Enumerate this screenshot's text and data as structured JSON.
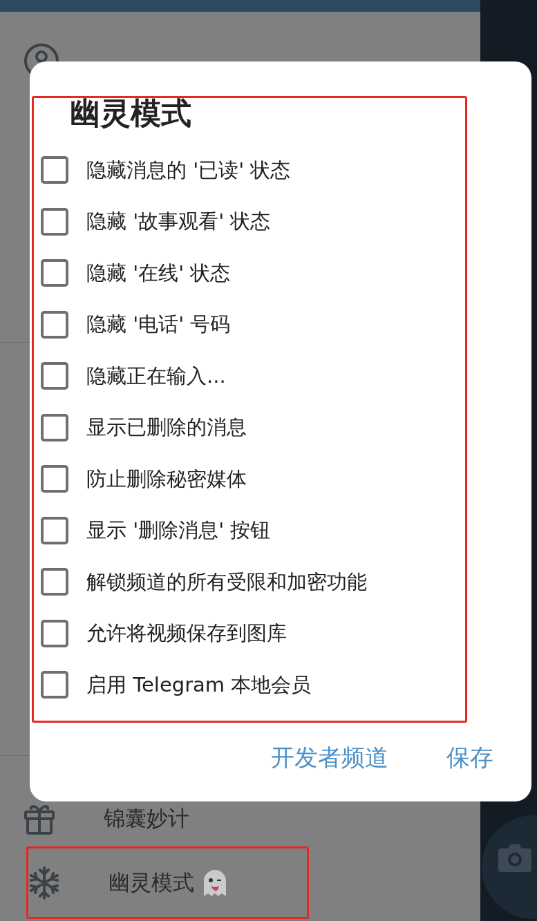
{
  "drawer": {
    "items": [
      {
        "kind": "gift",
        "label": "锦囊妙计",
        "ghost": false,
        "annotated": false
      },
      {
        "kind": "snowflake",
        "label": "幽灵模式",
        "ghost": true,
        "annotated": true
      }
    ]
  },
  "dialog": {
    "title": "幽灵模式",
    "annotated": true,
    "options": [
      {
        "label": "隐藏消息的 '已读' 状态",
        "checked": false
      },
      {
        "label": "隐藏 '故事观看' 状态",
        "checked": false
      },
      {
        "label": "隐藏 '在线' 状态",
        "checked": false
      },
      {
        "label": "隐藏 '电话' 号码",
        "checked": false
      },
      {
        "label": "隐藏正在输入...",
        "checked": false
      },
      {
        "label": "显示已删除的消息",
        "checked": false
      },
      {
        "label": "防止删除秘密媒体",
        "checked": false
      },
      {
        "label": "显示 '删除消息' 按钮",
        "checked": false
      },
      {
        "label": "解锁频道的所有受限和加密功能",
        "checked": false
      },
      {
        "label": "允许将视频保存到图库",
        "checked": false
      },
      {
        "label": "启用 Telegram 本地会员",
        "checked": false
      }
    ],
    "buttons": [
      {
        "label": "开发者频道"
      },
      {
        "label": "保存"
      }
    ]
  }
}
